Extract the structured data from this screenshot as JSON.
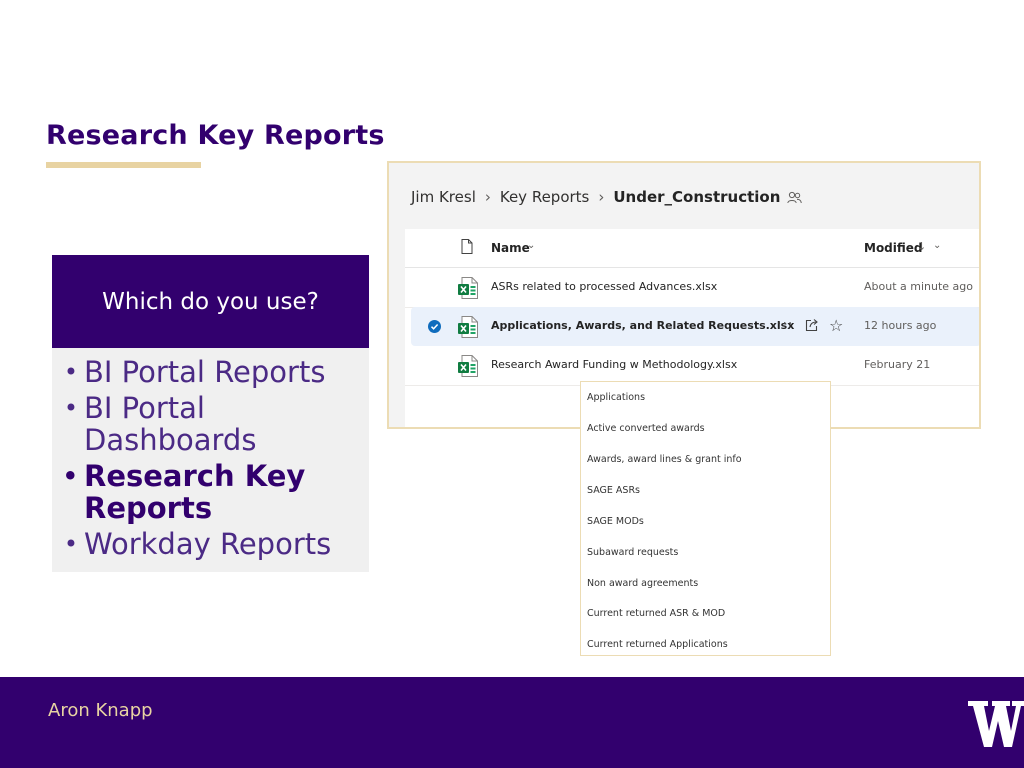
{
  "slide": {
    "title": "Research Key Reports",
    "question": "Which do you use?",
    "bullets": [
      {
        "text": "BI Portal Reports",
        "bold": false
      },
      {
        "text": "BI Portal Dashboards",
        "bold": false
      },
      {
        "text": "Research Key Reports",
        "bold": true
      },
      {
        "text": "Workday Reports",
        "bold": false
      }
    ],
    "footer_name": "Aron Knapp"
  },
  "breadcrumb": {
    "items": [
      "Jim Kresl",
      "Key Reports"
    ],
    "current": "Under_Construction"
  },
  "file_list": {
    "col_name": "Name",
    "col_modified": "Modified",
    "sort_indicator": "↓",
    "files": [
      {
        "name": "ASRs related to processed Advances.xlsx",
        "modified": "About a minute ago",
        "selected": false
      },
      {
        "name": "Applications, Awards, and Related Requests.xlsx",
        "modified": "12 hours ago",
        "selected": true
      },
      {
        "name": "Research Award Funding w Methodology.xlsx",
        "modified": "February 21",
        "selected": false
      }
    ]
  },
  "dropdown_items": [
    "Applications",
    "Active converted awards",
    "Awards, award lines & grant info",
    "SAGE ASRs",
    "SAGE MODs",
    "Subaward requests",
    "Non award agreements",
    "Current returned ASR & MOD",
    "Current returned Applications"
  ],
  "colors": {
    "uw_purple": "#32006e",
    "uw_gold": "#e8d3a2",
    "excel_green": "#107c41",
    "selection_blue": "#0f6cbd"
  },
  "icons": {
    "file_type": "excel-icon",
    "row_actions": [
      "more-icon",
      "share-icon",
      "star-icon"
    ],
    "selection": "check-circle-icon",
    "folder_shared": "people-icon",
    "logo": "uw-w-logo"
  }
}
